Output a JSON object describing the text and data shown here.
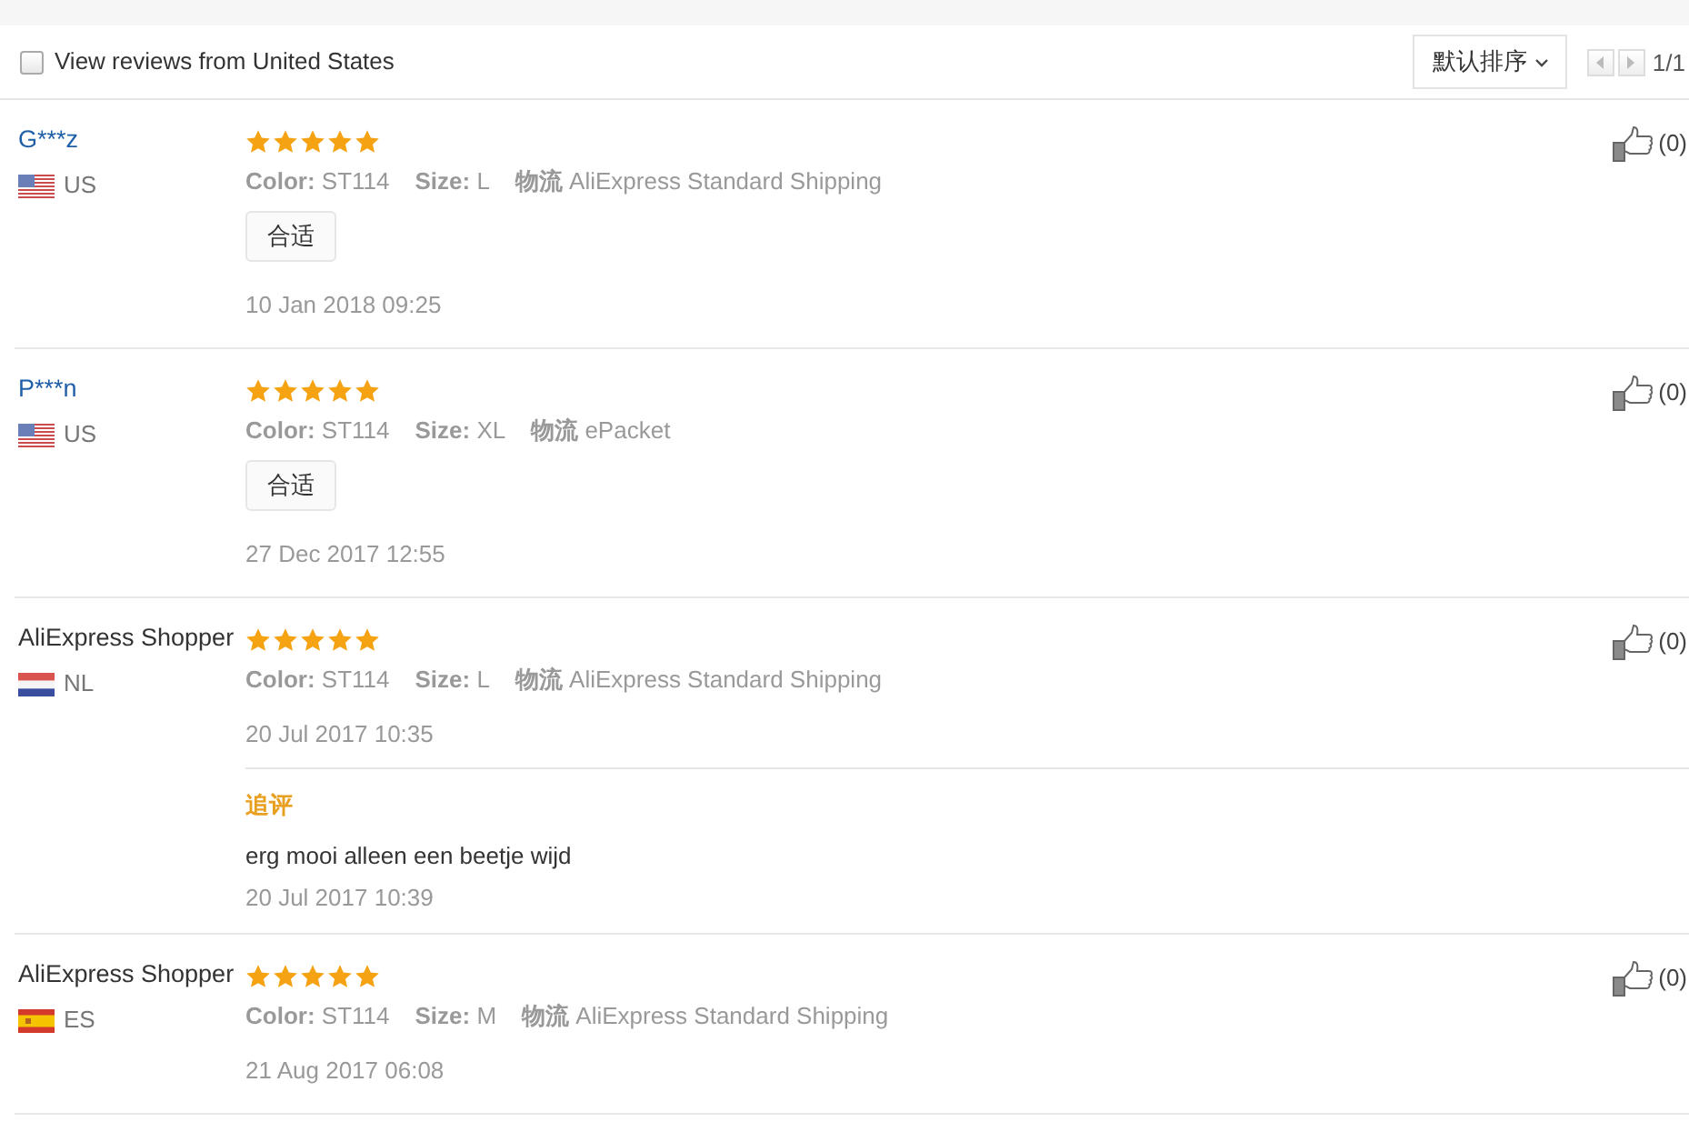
{
  "filter": {
    "label": "View reviews from United States",
    "checked": false
  },
  "sort": {
    "label": "默认排序"
  },
  "pager": {
    "text": "1/1"
  },
  "reviews": [
    {
      "name": "G***z",
      "linked": true,
      "flag": {
        "kind": "us"
      },
      "country": "US",
      "stars": 5,
      "attributes": [
        "**Color:** ST114",
        "**Size:** L",
        "**物流** AliExpress Standard Shipping"
      ],
      "tags": [
        "合适"
      ],
      "date": "10 Jan 2018 09:25",
      "likes": "(0)"
    },
    {
      "name": "P***n",
      "linked": true,
      "flag": {
        "kind": "us"
      },
      "country": "US",
      "stars": 5,
      "attributes": [
        "**Color:** ST114",
        "**Size:** XL",
        "**物流** ePacket"
      ],
      "tags": [
        "合适"
      ],
      "date": "27 Dec 2017 12:55",
      "likes": "(0)"
    },
    {
      "name": "AliExpress Shopper",
      "linked": false,
      "flag": {
        "kind": "nl"
      },
      "country": "NL",
      "stars": 5,
      "attributes": [
        "**Color:** ST114",
        "**Size:** L",
        "**物流** AliExpress Standard Shipping"
      ],
      "date": "20 Jul 2017 10:35",
      "likes": "(0)",
      "followup": {
        "label": "追评",
        "text": "erg mooi alleen een beetje wijd",
        "date": "20 Jul 2017 10:39"
      }
    },
    {
      "name": "AliExpress Shopper",
      "linked": false,
      "flag": {
        "kind": "es"
      },
      "country": "ES",
      "stars": 5,
      "attributes": [
        "**Color:** ST114",
        "**Size:** M",
        "**物流** AliExpress Standard Shipping"
      ],
      "date": "21 Aug 2017 06:08",
      "likes": "(0)"
    }
  ]
}
